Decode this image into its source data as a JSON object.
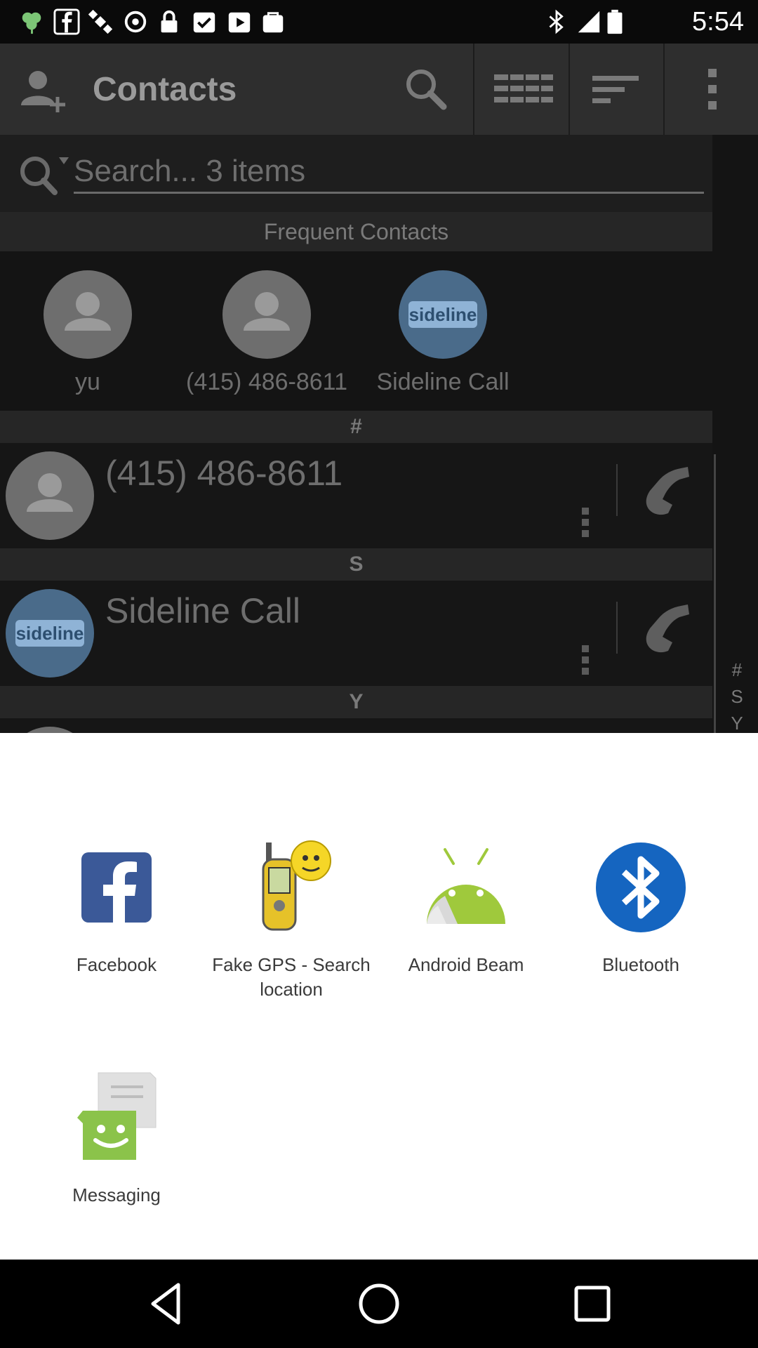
{
  "status_bar": {
    "time": "5:54",
    "icons": [
      "clover-icon",
      "facebook-icon",
      "satellite-icon",
      "sync-icon",
      "lock-icon",
      "checkbox-icon",
      "play-store-icon",
      "bag-icon",
      "bluetooth-icon",
      "signal-icon",
      "battery-icon"
    ]
  },
  "app": {
    "title": "Contacts",
    "search_placeholder": "Search... 3 items",
    "frequent_header": "Frequent Contacts",
    "frequent": [
      {
        "label": "yu",
        "avatar": "person"
      },
      {
        "label": "(415) 486-8611",
        "avatar": "person"
      },
      {
        "label": "Sideline Call",
        "avatar": "sideline"
      }
    ],
    "sections": [
      {
        "letter": "#",
        "contact": "(415) 486-8611"
      },
      {
        "letter": "S",
        "contact": "Sideline Call"
      },
      {
        "letter": "Y",
        "contact": ""
      }
    ],
    "index_letters": [
      "#",
      "S",
      "Y"
    ],
    "sideline_logo_text": "sideline"
  },
  "share_sheet": {
    "items": [
      {
        "label": "Facebook",
        "icon": "facebook-icon"
      },
      {
        "label": "Fake GPS - Search location",
        "icon": "fake-gps-icon"
      },
      {
        "label": "Android Beam",
        "icon": "android-beam-icon"
      },
      {
        "label": "Bluetooth",
        "icon": "bluetooth-icon"
      },
      {
        "label": "Messaging",
        "icon": "messaging-icon"
      }
    ]
  },
  "nav": [
    "back-icon",
    "home-icon",
    "recents-icon"
  ],
  "colors": {
    "facebook_blue": "#3b5998",
    "android_green": "#9fc93c",
    "bluetooth_blue": "#1565c0",
    "messaging_green": "#8bc34a"
  }
}
